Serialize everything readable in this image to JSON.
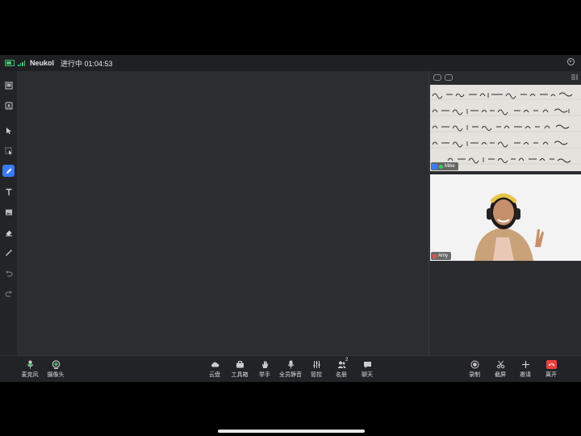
{
  "status": {
    "app_name": "Neukol",
    "meeting_status": "进行中 01:04:53"
  },
  "left_tools": [
    {
      "name": "whiteboard-list-icon"
    },
    {
      "name": "screen-select-icon"
    },
    {
      "name": "pointer-icon"
    },
    {
      "name": "box-select-icon"
    },
    {
      "name": "pen-icon",
      "active": true
    },
    {
      "name": "text-icon"
    },
    {
      "name": "image-icon"
    },
    {
      "name": "eraser-icon"
    },
    {
      "name": "magic-wand-icon"
    },
    {
      "name": "undo-icon"
    },
    {
      "name": "redo-icon"
    }
  ],
  "videos": [
    {
      "participant": "Mike",
      "content": "handwritten math formulas"
    },
    {
      "participant": "Amy",
      "content": "person with headphones"
    }
  ],
  "bottom": {
    "mic": "麦克风",
    "camera": "摄像头",
    "cloud": "云盘",
    "toolbox": "工具箱",
    "raise_hand": "举手",
    "mute_all": "全员静音",
    "control": "管控",
    "roster": "名册",
    "roster_count": "2",
    "chat": "聊天",
    "record": "录制",
    "screenshot": "截屏",
    "invite": "邀请",
    "leave": "离开"
  },
  "colors": {
    "accent": "#3c7bf5",
    "success": "#3ec46d",
    "danger": "#e8413c",
    "background": "#2b2c2f"
  }
}
